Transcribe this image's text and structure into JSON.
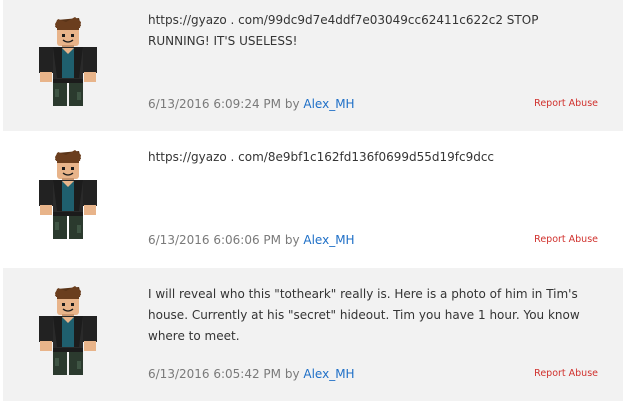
{
  "comments": [
    {
      "text": "https://gyazo . com/99dc9d7e4ddf7e03049cc62411c622c2 STOP RUNNING! IT'S USELESS!",
      "timestamp": "6/13/2016 6:09:24 PM",
      "by": "by",
      "author": "Alex_MH",
      "report": "Report Abuse"
    },
    {
      "text": "https://gyazo . com/8e9bf1c162fd136f0699d55d19fc9dcc",
      "timestamp": "6/13/2016 6:06:06 PM",
      "by": "by",
      "author": "Alex_MH",
      "report": "Report Abuse"
    },
    {
      "text": "I will reveal who this \"totheark\" really is. Here is a photo of him in Tim's house. Currently at his \"secret\" hideout. Tim you have 1 hour. You know where to meet.",
      "timestamp": "6/13/2016 6:05:42 PM",
      "by": "by",
      "author": "Alex_MH",
      "report": "Report Abuse"
    }
  ],
  "colors": {
    "shaded_row": "#f2f2f2",
    "author_link": "#1e6fc7",
    "report_link": "#d0312d",
    "meta_text": "#7a7a7a",
    "body_text": "#343434"
  },
  "icons": {
    "avatar": "roblox-avatar-icon"
  }
}
